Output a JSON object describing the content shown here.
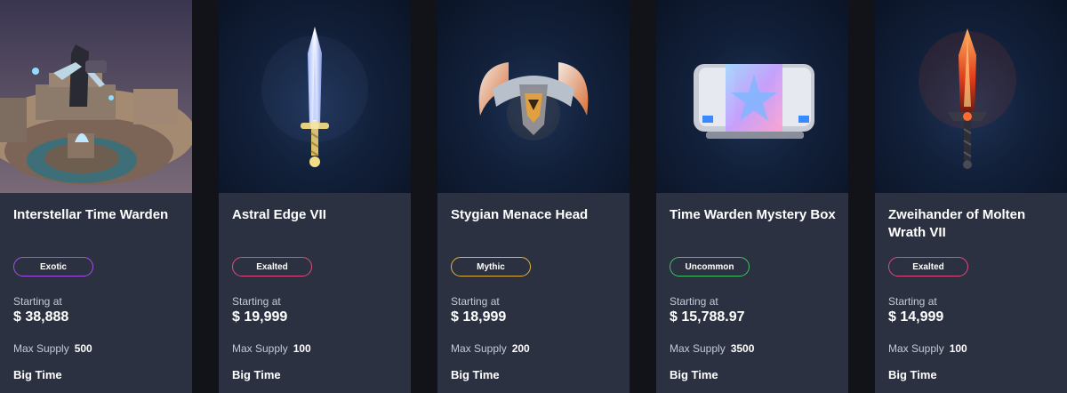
{
  "items": [
    {
      "title": "Interstellar Time Warden",
      "rarity": "Exotic",
      "rarity_color": "#a64ee8",
      "starting_label": "Starting at",
      "price": "$ 38,888",
      "supply_label": "Max Supply",
      "supply": "500",
      "publisher": "Big Time",
      "art_icon": "time-warden-scene-icon"
    },
    {
      "title": "Astral Edge VII",
      "rarity": "Exalted",
      "rarity_color": "#e04a7e",
      "starting_label": "Starting at",
      "price": "$ 19,999",
      "supply_label": "Max Supply",
      "supply": "100",
      "publisher": "Big Time",
      "art_icon": "sword-icon"
    },
    {
      "title": "Stygian Menace Head",
      "rarity": "Mythic",
      "rarity_color": "#e0b43a",
      "starting_label": "Starting at",
      "price": "$ 18,999",
      "supply_label": "Max Supply",
      "supply": "200",
      "publisher": "Big Time",
      "art_icon": "horned-helmet-icon"
    },
    {
      "title": "Time Warden Mystery Box",
      "rarity": "Uncommon",
      "rarity_color": "#3fc06a",
      "starting_label": "Starting at",
      "price": "$ 15,788.97",
      "supply_label": "Max Supply",
      "supply": "3500",
      "publisher": "Big Time",
      "art_icon": "mystery-box-icon"
    },
    {
      "title": "Zweihander of Molten Wrath VII",
      "rarity": "Exalted",
      "rarity_color": "#e04a7e",
      "starting_label": "Starting at",
      "price": "$ 14,999",
      "supply_label": "Max Supply",
      "supply": "100",
      "publisher": "Big Time",
      "art_icon": "molten-sword-icon"
    }
  ]
}
